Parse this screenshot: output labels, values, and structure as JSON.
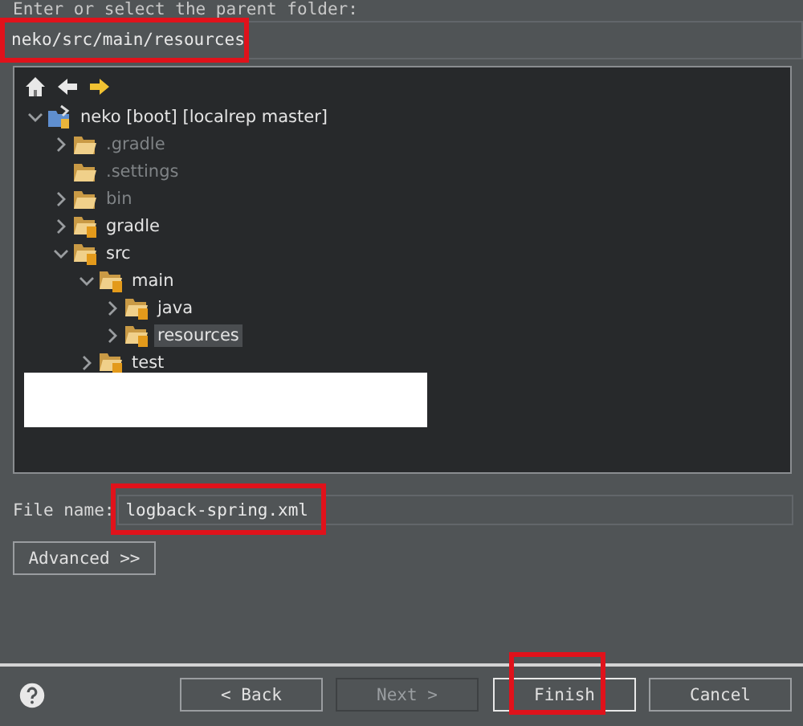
{
  "folder_prompt": "Enter or select the parent folder:",
  "parent_folder": {
    "value": "neko/src/main/resources",
    "highlighted": true
  },
  "tree": {
    "redacted": true,
    "items": [
      {
        "label": "neko [boot] [localrep master]",
        "kind": "project",
        "expanded": true,
        "dimmed": false,
        "selected": false,
        "children": [
          {
            "label": ".gradle",
            "kind": "folder",
            "expanded": false,
            "dimmed": true,
            "selected": false
          },
          {
            "label": ".settings",
            "kind": "folder",
            "dimmed": true,
            "selected": false
          },
          {
            "label": "bin",
            "kind": "folder",
            "expanded": false,
            "dimmed": true,
            "selected": false
          },
          {
            "label": "gradle",
            "kind": "source-folder",
            "expanded": false,
            "dimmed": false,
            "selected": false
          },
          {
            "label": "src",
            "kind": "source-folder",
            "expanded": true,
            "dimmed": false,
            "selected": false,
            "children": [
              {
                "label": "main",
                "kind": "source-folder",
                "expanded": true,
                "dimmed": false,
                "selected": false,
                "children": [
                  {
                    "label": "java",
                    "kind": "source-folder",
                    "expanded": false,
                    "dimmed": false,
                    "selected": false
                  },
                  {
                    "label": "resources",
                    "kind": "source-folder",
                    "expanded": false,
                    "dimmed": false,
                    "selected": true
                  }
                ]
              },
              {
                "label": "test",
                "kind": "source-folder",
                "expanded": false,
                "dimmed": false,
                "selected": false
              }
            ]
          }
        ]
      }
    ]
  },
  "file_name": {
    "label": "File name:",
    "value": "logback-spring.xml",
    "highlighted": true
  },
  "advanced_button": "Advanced >>",
  "buttons": [
    {
      "label": "< Back",
      "disabled": false,
      "highlighted": false
    },
    {
      "label": "Next >",
      "disabled": true,
      "highlighted": false
    },
    {
      "label": "Finish",
      "disabled": false,
      "highlighted": true
    },
    {
      "label": "Cancel",
      "disabled": false,
      "highlighted": false
    }
  ]
}
